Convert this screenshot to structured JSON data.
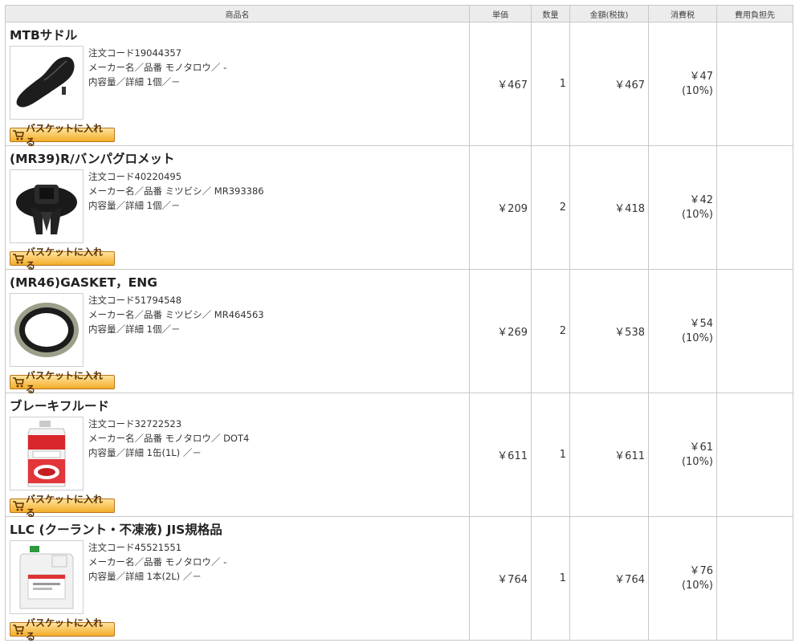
{
  "headers": [
    "商品名",
    "単価",
    "数量",
    "金額(税抜)",
    "消費税",
    "費用負担先"
  ],
  "labels": {
    "code_prefix": "注文コード",
    "maker_prefix": "メーカー名／品番 ",
    "detail_prefix": "内容量／詳細 ",
    "basket_button": "バスケットに入れる"
  },
  "items": [
    {
      "name": "MTBサドル",
      "code": "19044357",
      "maker": "モノタロウ／ -",
      "detail": "1個／－",
      "unit_price": "￥467",
      "qty": "1",
      "amount": "￥467",
      "tax": "￥47",
      "tax_rate": "(10%)",
      "cost_bearer": "",
      "image": "saddle-image"
    },
    {
      "name": "(MR39)R/バンパグロメット",
      "code": "40220495",
      "maker": "ミツビシ／ MR393386",
      "detail": "1個／－",
      "unit_price": "￥209",
      "qty": "2",
      "amount": "￥418",
      "tax": "￥42",
      "tax_rate": "(10%)",
      "cost_bearer": "",
      "image": "grommet-image"
    },
    {
      "name": "(MR46)GASKET，ENG",
      "code": "51794548",
      "maker": "ミツビシ／ MR464563",
      "detail": "1個／－",
      "unit_price": "￥269",
      "qty": "2",
      "amount": "￥538",
      "tax": "￥54",
      "tax_rate": "(10%)",
      "cost_bearer": "",
      "image": "gasket-image"
    },
    {
      "name": "ブレーキフルード",
      "code": "32722523",
      "maker": "モノタロウ／ DOT4",
      "detail": "1缶(1L) ／－",
      "unit_price": "￥611",
      "qty": "1",
      "amount": "￥611",
      "tax": "￥61",
      "tax_rate": "(10%)",
      "cost_bearer": "",
      "image": "brake-fluid-can-image"
    },
    {
      "name": "LLC (クーラント・不凍液) JIS規格品",
      "code": "45521551",
      "maker": "モノタロウ／ -",
      "detail": "1本(2L) ／－",
      "unit_price": "￥764",
      "qty": "1",
      "amount": "￥764",
      "tax": "￥76",
      "tax_rate": "(10%)",
      "cost_bearer": "",
      "image": "coolant-jug-image"
    }
  ],
  "colors": {
    "header_bg": "#ececec",
    "border": "#c8c8c8",
    "button_top": "#ffe39a",
    "button_bottom": "#f3ad2a"
  }
}
